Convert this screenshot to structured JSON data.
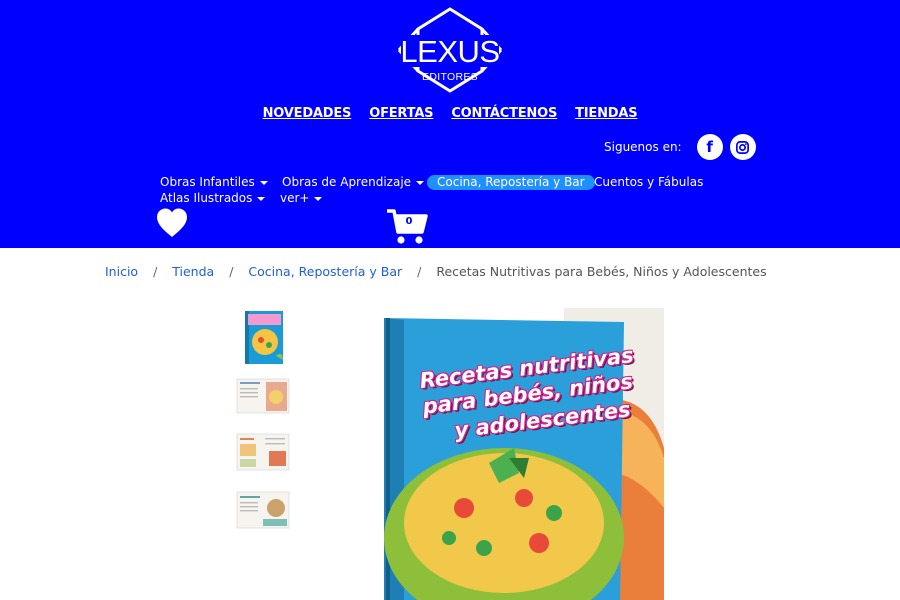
{
  "brand": {
    "name": "LEXUS",
    "subtitle": "EDITORES"
  },
  "top_nav": [
    "NOVEDADES",
    "OFERTAS",
    "CONTÁCTENOS",
    "TIENDAS"
  ],
  "social": {
    "label": "Siguenos en:",
    "icons": [
      "facebook-icon",
      "instagram-icon"
    ]
  },
  "categories": {
    "obras_infantiles": "Obras Infantiles",
    "obras_aprendizaje": "Obras de Aprendizaje",
    "cocina": "Cocina, Repostería y Bar",
    "cuentos": "Cuentos y Fábulas",
    "atlas": "Atlas Ilustrados",
    "ver_mas": "ver+"
  },
  "cart": {
    "count": "0"
  },
  "breadcrumb": {
    "inicio": "Inicio",
    "tienda": "Tienda",
    "categoria": "Cocina, Repostería y Bar",
    "current": "Recetas Nutritivas para Bebés, Niños y Adolescentes"
  },
  "product": {
    "cover_title_lines": [
      "Recetas nutritivas",
      "para bebés, niños",
      "y adolescentes"
    ],
    "thumbnails": [
      "cover",
      "page-1",
      "page-2",
      "page-3"
    ]
  },
  "colors": {
    "header_bg": "#0000ff",
    "active_category_bg": "#1e90ff",
    "link": "#1f5fd6"
  }
}
